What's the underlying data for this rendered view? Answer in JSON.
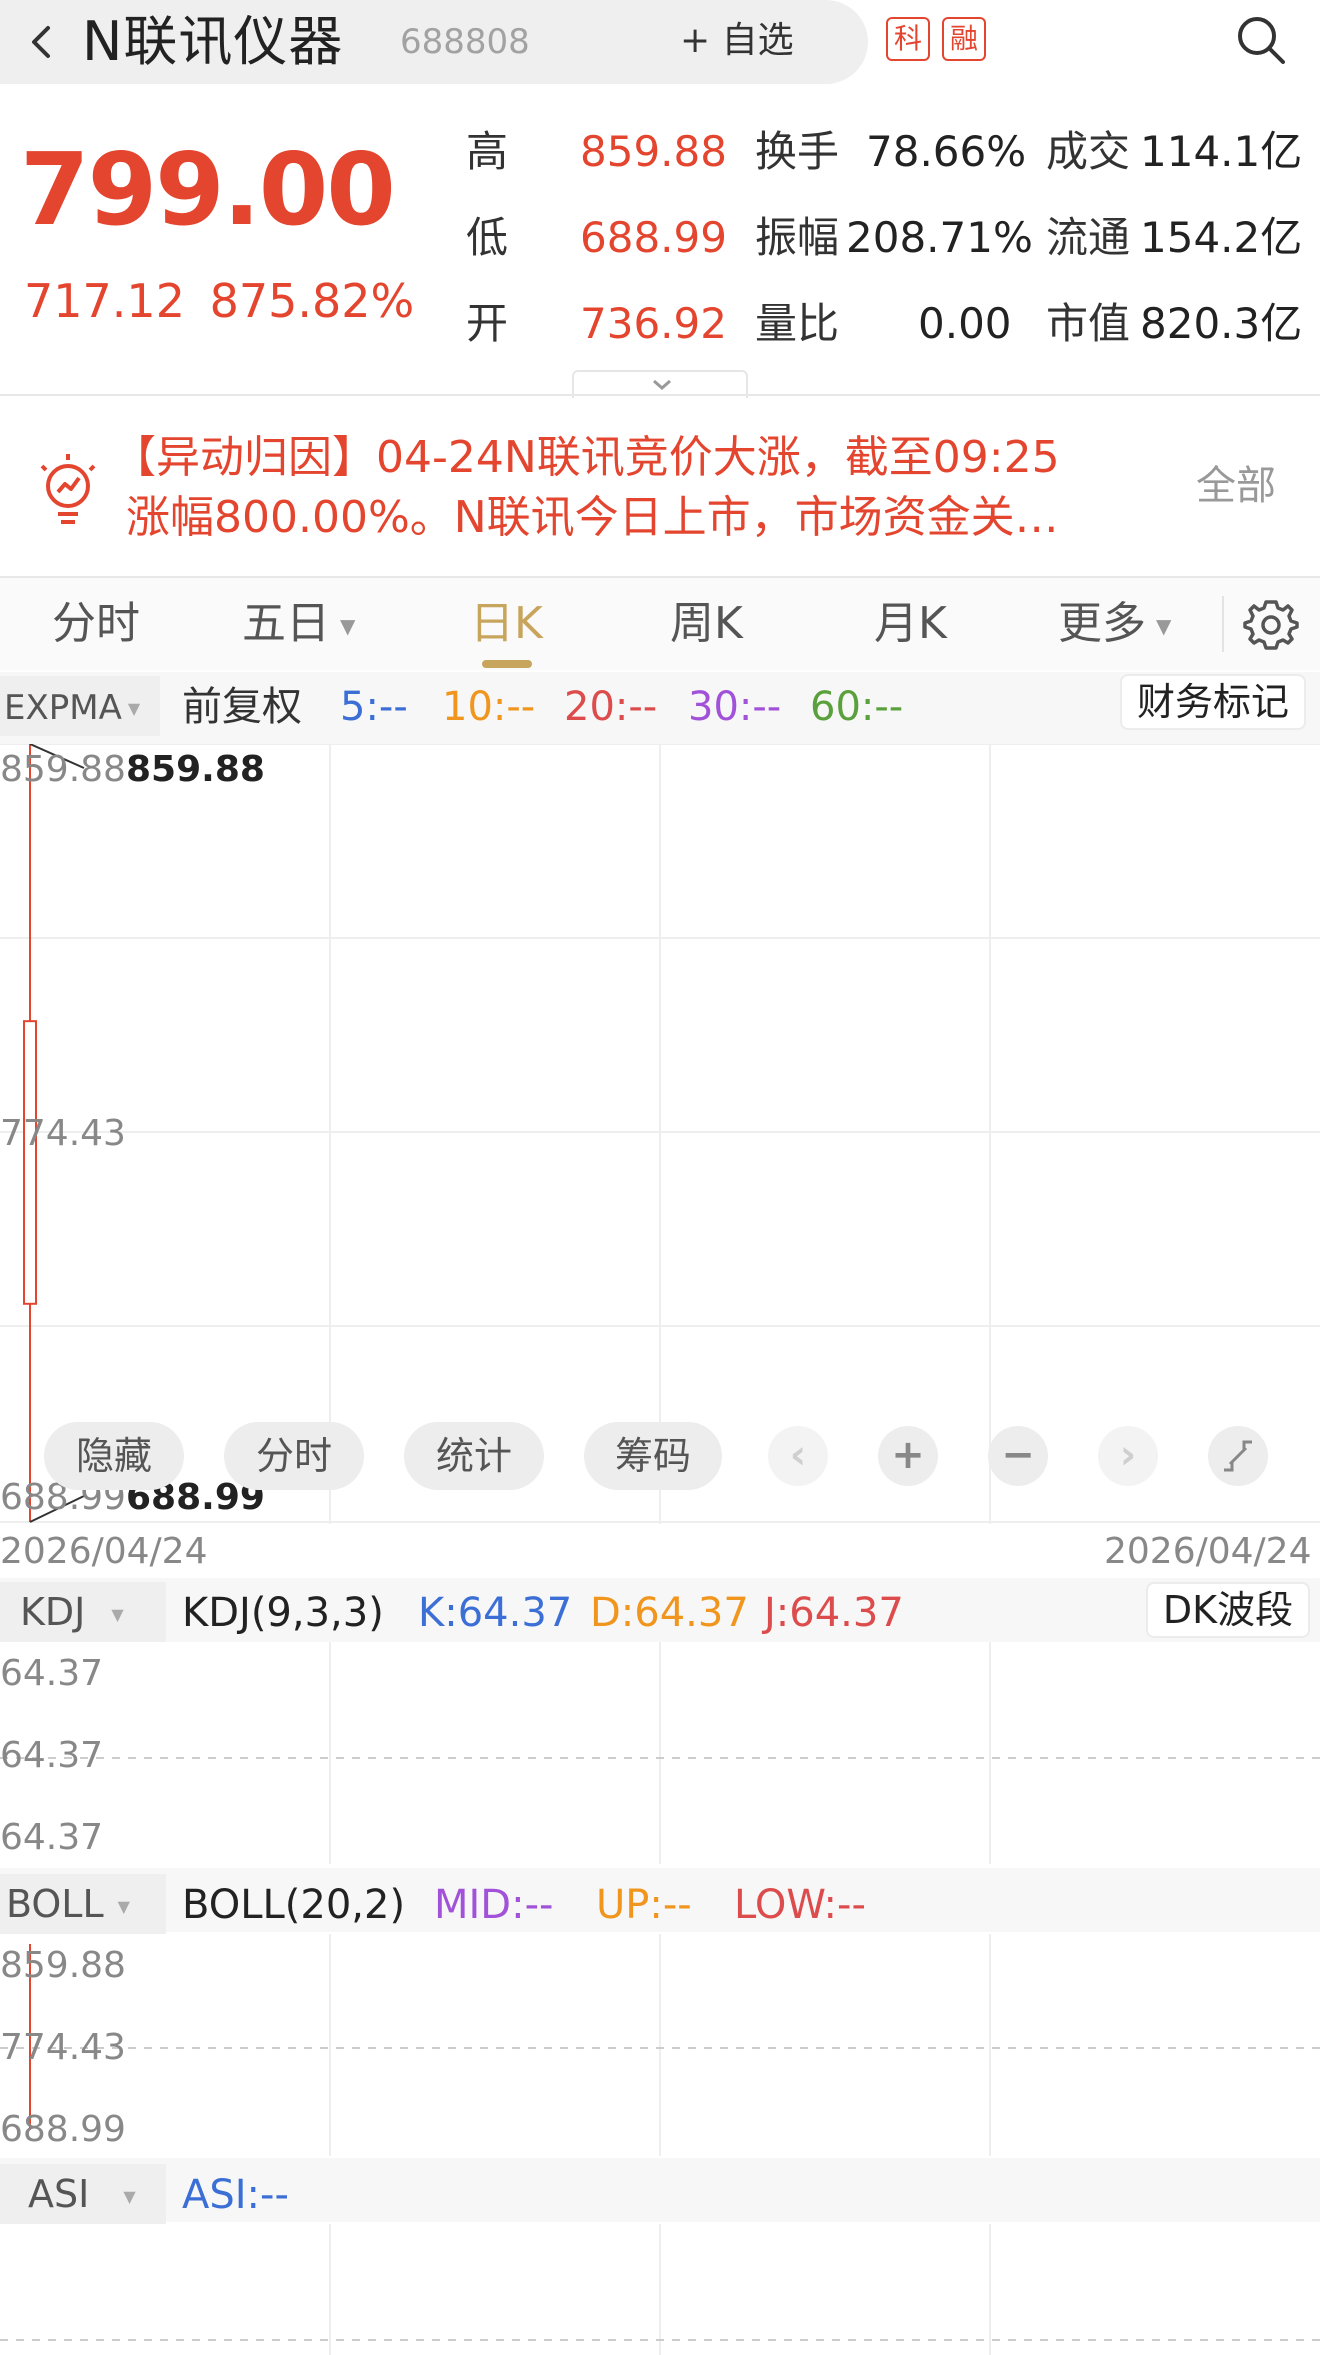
{
  "header": {
    "back_icon": "chevron-left-icon",
    "title": "N联讯仪器",
    "code": "688808",
    "add_fav": "+ 自选",
    "badges": [
      "科",
      "融"
    ],
    "search_icon": "search-icon"
  },
  "quote": {
    "price": "799.00",
    "change": "717.12",
    "change_pct": "875.82%",
    "rows": [
      {
        "label": "高",
        "value": "859.88",
        "label2": "换手",
        "value2": "78.66%",
        "label3": "成交",
        "value3": "114.1亿"
      },
      {
        "label": "低",
        "value": "688.99",
        "label2": "振幅",
        "value2": "208.71%",
        "label3": "流通",
        "value3": "154.2亿"
      },
      {
        "label": "开",
        "value": "736.92",
        "label2": "量比",
        "value2": "0.00",
        "label3": "市值",
        "value3": "820.3亿"
      }
    ]
  },
  "news": {
    "line1": "【异动归因】04-24N联讯竞价大涨，截至09:25",
    "line2": "涨幅800.00%。N联讯今日上市，市场资金关…",
    "all_label": "全部"
  },
  "tabs": [
    {
      "label": "分时",
      "active": false
    },
    {
      "label": "五日",
      "active": false
    },
    {
      "label": "日K",
      "active": true
    },
    {
      "label": "周K",
      "active": false
    },
    {
      "label": "月K",
      "active": false
    },
    {
      "label": "更多",
      "active": false
    }
  ],
  "main_chart": {
    "indicator": "EXPMA",
    "adjust": "前复权",
    "ma": [
      {
        "label": "5:--",
        "color": "#3b6fd6"
      },
      {
        "label": "10:--",
        "color": "#f0961e"
      },
      {
        "label": "20:--",
        "color": "#dd4c4c"
      },
      {
        "label": "30:--",
        "color": "#a152d8"
      },
      {
        "label": "60:--",
        "color": "#5aa03c"
      }
    ],
    "finance_mark": "财务标记",
    "y_high": "859.88",
    "y_mid": "774.43",
    "y_low": "688.99",
    "high_label": "859.88",
    "low_label": "688.99",
    "date_start": "2026/04/24",
    "date_end": "2026/04/24",
    "buttons": [
      "隐藏",
      "分时",
      "统计",
      "筹码"
    ],
    "candle": {
      "open": 736.92,
      "close": 799.0,
      "high": 859.88,
      "low": 688.99
    }
  },
  "kdj": {
    "indicator": "KDJ",
    "params": "KDJ(9,3,3)",
    "k": "K:64.37",
    "d": "D:64.37",
    "j": "J:64.37",
    "dk": "DK波段",
    "y": [
      "64.37",
      "64.37",
      "64.37"
    ]
  },
  "boll": {
    "indicator": "BOLL",
    "params": "BOLL(20,2)",
    "mid": "MID:--",
    "up": "UP:--",
    "low": "LOW:--",
    "y": [
      "859.88",
      "774.43",
      "688.99"
    ]
  },
  "asi": {
    "indicator": "ASI",
    "value": "ASI:--"
  },
  "colors": {
    "up": "#e4452f",
    "accent": "#c8a55d"
  }
}
